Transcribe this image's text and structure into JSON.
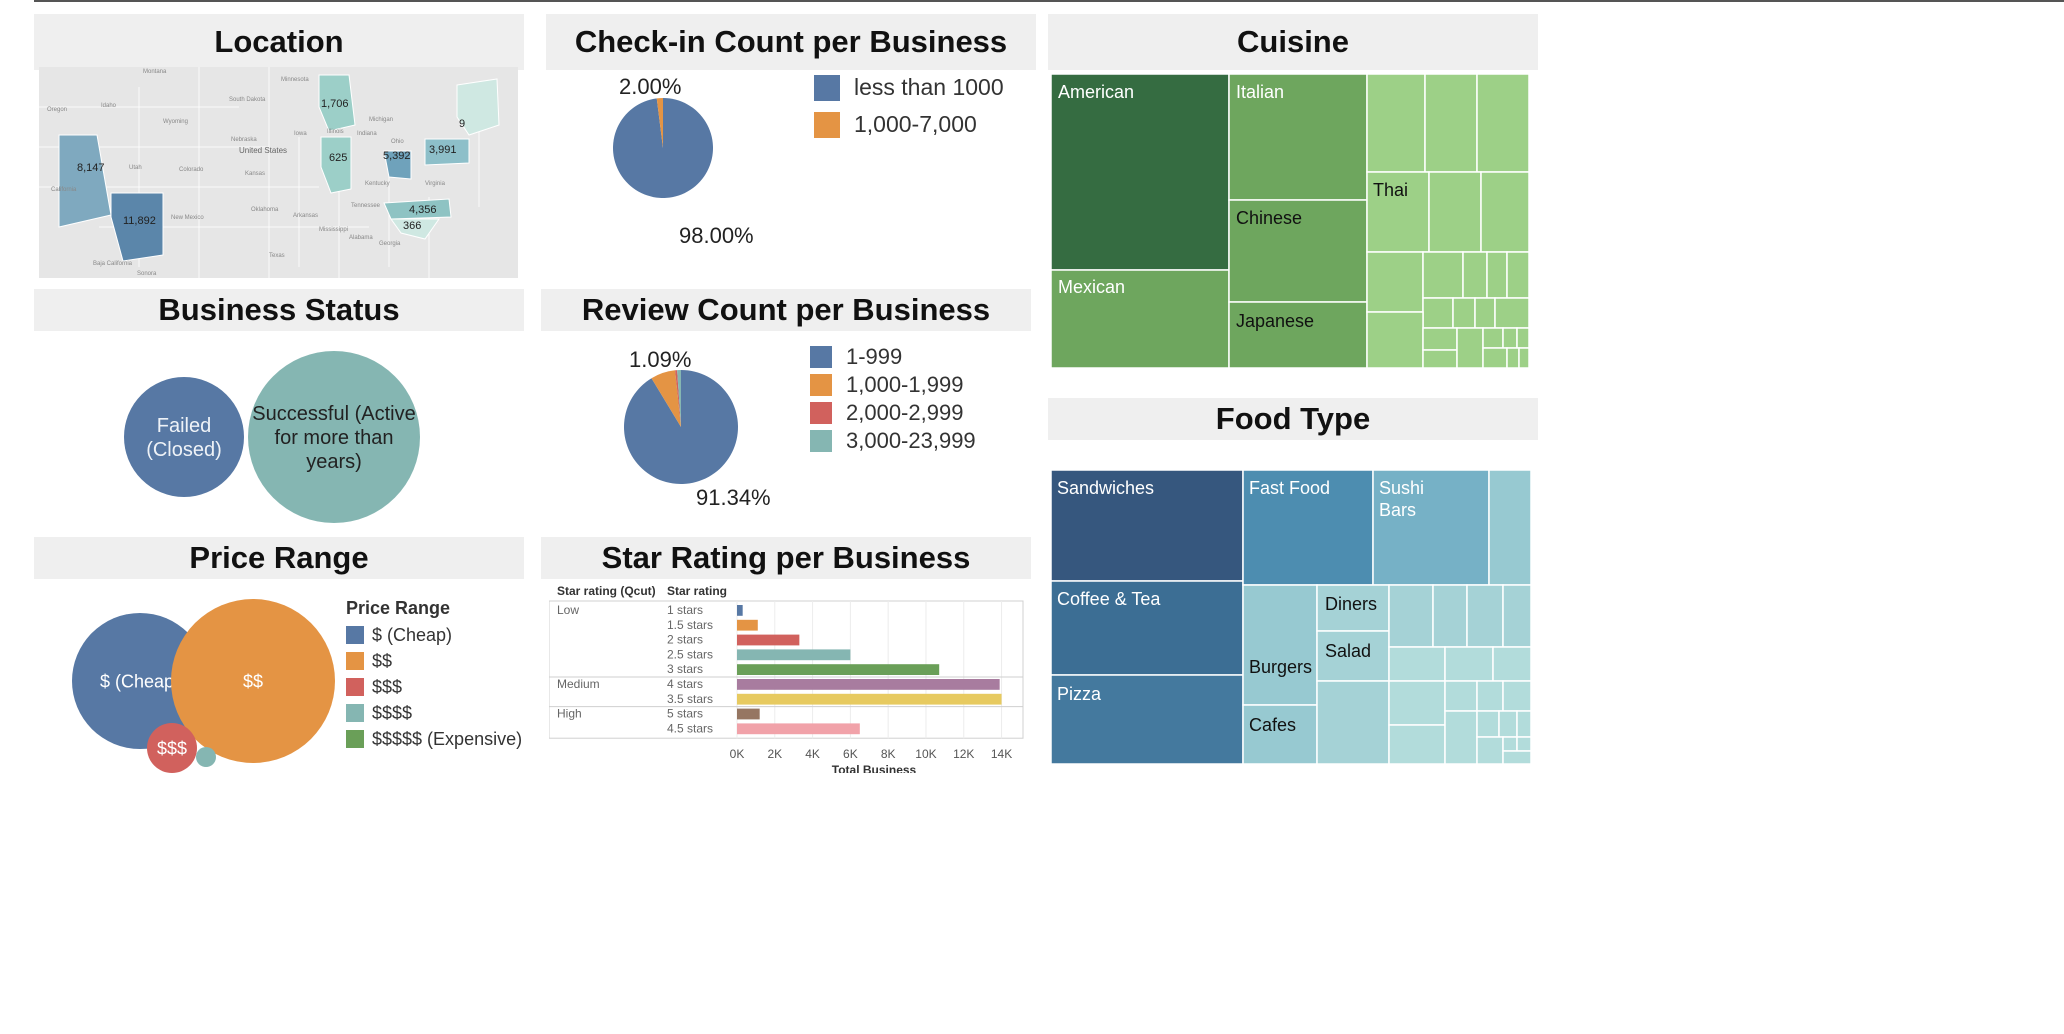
{
  "panels": {
    "location": "Location",
    "checkin": "Check-in Count per Business",
    "cuisine": "Cuisine",
    "status": "Business Status",
    "review": "Review Count per Business",
    "foodtype": "Food Type",
    "price": "Price Range",
    "star": "Star Rating per Business"
  },
  "map": {
    "places": [
      "Montana",
      "Minnesota",
      "Oregon",
      "Idaho",
      "South Dakota",
      "Wyoming",
      "Michigan",
      "Nebraska",
      "Iowa",
      "United States",
      "Utah",
      "Colorado",
      "Kansas",
      "California",
      "Illinois",
      "Indiana",
      "Ohio",
      "Kentucky",
      "Virginia",
      "Oklahoma",
      "Tennessee",
      "New Mexico",
      "Arkansas",
      "Mississippi",
      "Alabama",
      "Georgia",
      "Texas",
      "Baja California",
      "Sonora"
    ],
    "values": [
      "1,706",
      "8,147",
      "625",
      "5,392",
      "3,991",
      "9",
      "4,356",
      "366",
      "11,892"
    ]
  },
  "chart_data": [
    {
      "type": "pie",
      "title": "Check-in Count per Business",
      "labels": [
        "less than 1000",
        "1,000-7,000"
      ],
      "values": [
        98.0,
        2.0
      ],
      "value_labels": [
        "98.00%",
        "2.00%"
      ],
      "colors": [
        "#5778a4",
        "#e49444"
      ],
      "legend": "right"
    },
    {
      "type": "pie",
      "title": "Review Count per Business",
      "labels": [
        "1-999",
        "1,000-1,999",
        "2,000-2,999",
        "3,000-23,999"
      ],
      "values": [
        91.34,
        7.0,
        0.57,
        1.09
      ],
      "value_labels": [
        "91.34%",
        "",
        "",
        "1.09%"
      ],
      "colors": [
        "#5778a4",
        "#e49444",
        "#d1615d",
        "#85b6b2"
      ],
      "legend": "right"
    },
    {
      "type": "treemap",
      "title": "Cuisine",
      "labels": [
        "American",
        "Italian",
        "Thai",
        "Mexican",
        "Chinese",
        "Japanese"
      ]
    },
    {
      "type": "treemap",
      "title": "Food Type",
      "labels": [
        "Sandwiches",
        "Fast Food",
        "Sushi Bars",
        "Coffee & Tea",
        "Diners",
        "Salad",
        "Burgers",
        "Pizza",
        "Cafes"
      ]
    },
    {
      "type": "bubble",
      "title": "Business Status",
      "labels": [
        "Failed (Closed)",
        "Successful (Active for more than 3 years)"
      ],
      "colors": [
        "#5778a4",
        "#85b6b2"
      ]
    },
    {
      "type": "bubble",
      "title": "Price Range",
      "legend_title": "Price Range",
      "labels": [
        "$ (Cheap)",
        "$$",
        "$$$",
        "$$$$",
        "$$$$$ (Expensive)"
      ],
      "bubble_labels": [
        "$ (Cheap)",
        "$$",
        "$$$",
        "",
        ""
      ],
      "colors": [
        "#5778a4",
        "#e49444",
        "#d1615d",
        "#85b6b2",
        "#6a9f58"
      ],
      "legend": "right"
    },
    {
      "type": "bar",
      "orientation": "horizontal",
      "title": "Star Rating per Business",
      "column_headers": [
        "Star rating (Qcut)",
        "Star rating"
      ],
      "groups": [
        {
          "name": "Low",
          "rows": [
            {
              "label": "1 stars",
              "value": 300,
              "color": "#5778a4"
            },
            {
              "label": "1.5 stars",
              "value": 1100,
              "color": "#e49444"
            },
            {
              "label": "2 stars",
              "value": 3300,
              "color": "#d1615d"
            },
            {
              "label": "2.5 stars",
              "value": 6000,
              "color": "#85b6b2"
            },
            {
              "label": "3 stars",
              "value": 10700,
              "color": "#6a9f58"
            }
          ]
        },
        {
          "name": "Medium",
          "rows": [
            {
              "label": "4 stars",
              "value": 13900,
              "color": "#a87c9f"
            },
            {
              "label": "3.5 stars",
              "value": 14000,
              "color": "#e7ca60"
            }
          ]
        },
        {
          "name": "High",
          "rows": [
            {
              "label": "5 stars",
              "value": 1200,
              "color": "#967662"
            },
            {
              "label": "4.5 stars",
              "value": 6500,
              "color": "#f1a2a9"
            }
          ]
        }
      ],
      "xticks": [
        "0K",
        "2K",
        "4K",
        "6K",
        "8K",
        "10K",
        "12K",
        "14K"
      ],
      "xlim": [
        0,
        14500
      ],
      "xlabel": "Total Business"
    }
  ]
}
